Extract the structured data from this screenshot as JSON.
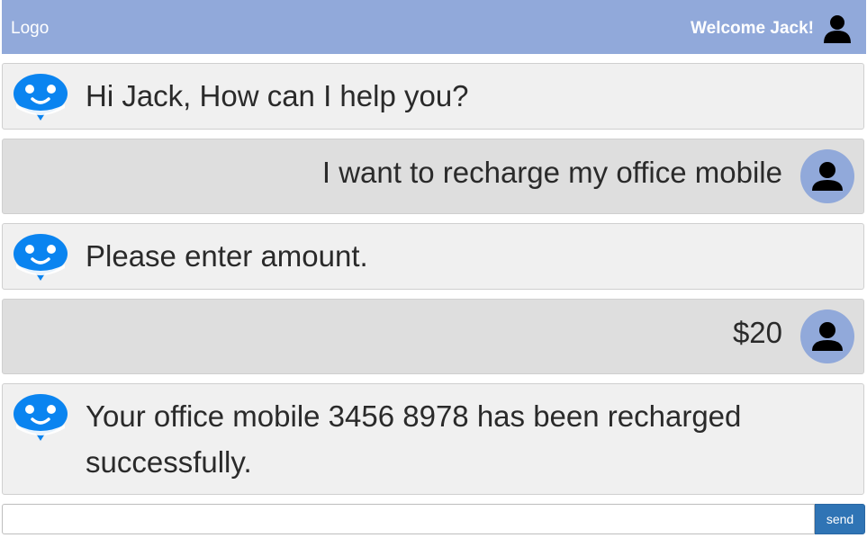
{
  "header": {
    "logo": "Logo",
    "welcome": "Welcome Jack!",
    "user_icon": "user-icon",
    "background_color": "#91a9da"
  },
  "messages": [
    {
      "sender": "bot",
      "icon": "chatbot-icon",
      "text": "Hi Jack, How can I help you?"
    },
    {
      "sender": "user",
      "icon": "user-avatar-icon",
      "text": "I want to recharge my office mobile"
    },
    {
      "sender": "bot",
      "icon": "chatbot-icon",
      "text": "Please enter amount."
    },
    {
      "sender": "user",
      "icon": "user-avatar-icon",
      "text": "$20"
    },
    {
      "sender": "bot",
      "icon": "chatbot-icon",
      "text": "Your office mobile 3456 8978 has been recharged successfully."
    }
  ],
  "composer": {
    "value": "",
    "placeholder": "",
    "send_label": "send",
    "send_color": "#2f74b5"
  },
  "colors": {
    "bot_bubble": "#f0f0f0",
    "user_bubble": "#dedede",
    "bot_icon": "#0a84f0"
  }
}
